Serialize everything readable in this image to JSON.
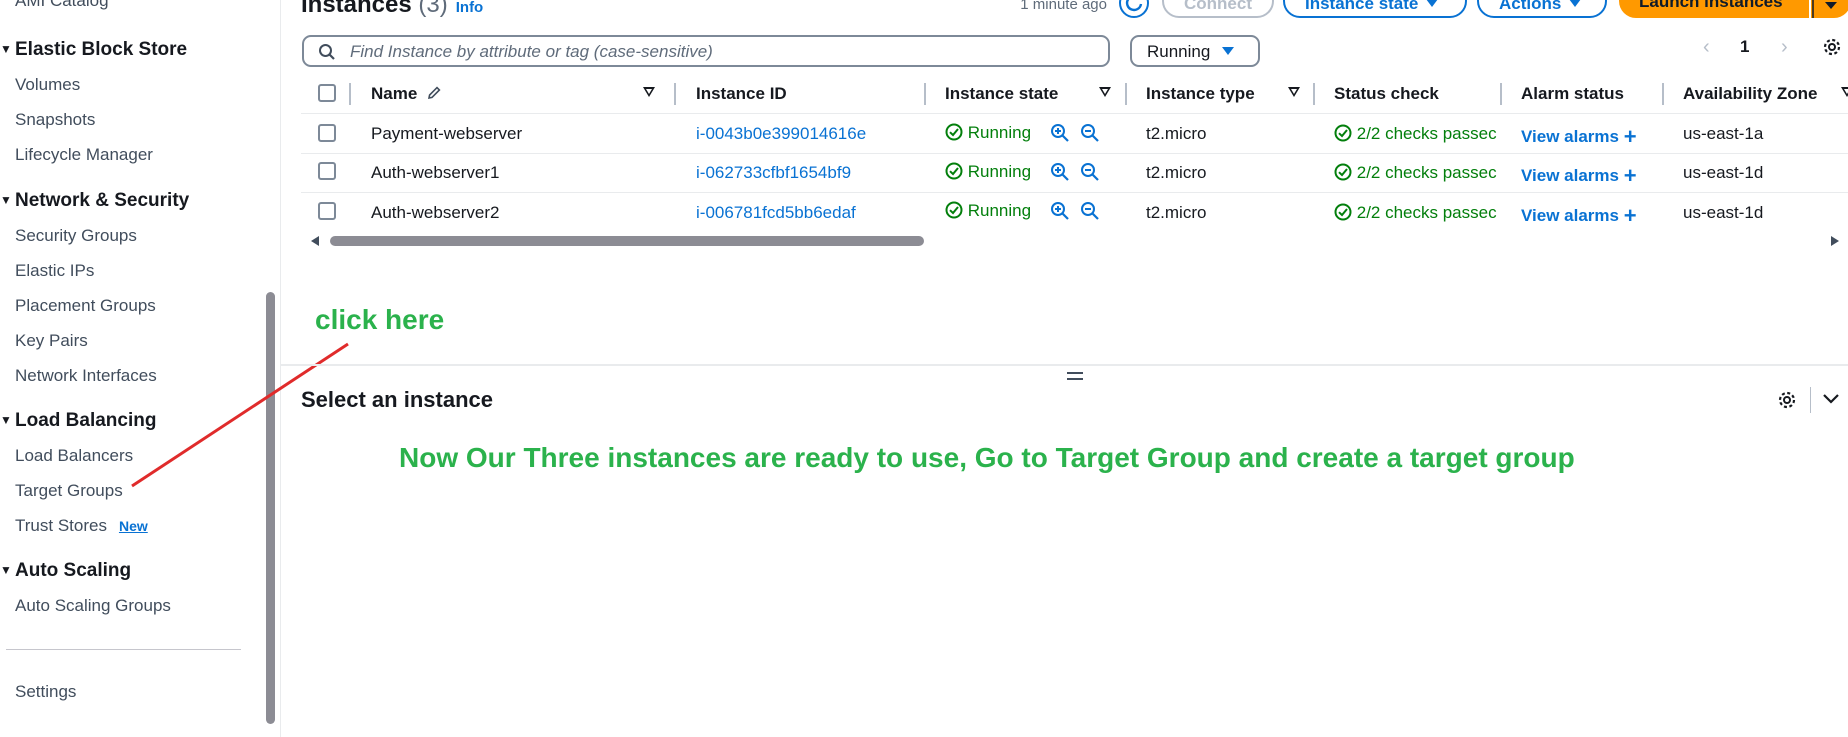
{
  "sidebar": {
    "clipped_item": "AMI Catalog",
    "sections": [
      {
        "title": "Elastic Block Store",
        "items": [
          "Volumes",
          "Snapshots",
          "Lifecycle Manager"
        ]
      },
      {
        "title": "Network & Security",
        "items": [
          "Security Groups",
          "Elastic IPs",
          "Placement Groups",
          "Key Pairs",
          "Network Interfaces"
        ]
      },
      {
        "title": "Load Balancing",
        "items": [
          "Load Balancers",
          "Target Groups",
          "Trust Stores"
        ]
      },
      {
        "title": "Auto Scaling",
        "items": [
          "Auto Scaling Groups"
        ]
      }
    ],
    "new_badge": "New",
    "settings": "Settings"
  },
  "instances": {
    "title": "Instances",
    "count": "(3)",
    "info": "Info",
    "last_updated": "1 minute ago",
    "buttons": {
      "connect": "Connect",
      "instance_state": "Instance state",
      "actions": "Actions",
      "launch": "Launch instances"
    }
  },
  "filter": {
    "search_placeholder": "Find Instance by attribute or tag (case-sensitive)",
    "state_filter": "Running",
    "page": "1"
  },
  "table": {
    "headers": [
      "Name",
      "Instance ID",
      "Instance state",
      "Instance type",
      "Status check",
      "Alarm status",
      "Availability Zone"
    ],
    "rows": [
      {
        "name": "Payment-webserver",
        "id": "i-0043b0e399014616e",
        "state": "Running",
        "type": "t2.micro",
        "status": "2/2 checks passec",
        "alarm": "View alarms",
        "az": "us-east-1a"
      },
      {
        "name": "Auth-webserver1",
        "id": "i-062733cfbf1654bf9",
        "state": "Running",
        "type": "t2.micro",
        "status": "2/2 checks passec",
        "alarm": "View alarms",
        "az": "us-east-1d"
      },
      {
        "name": "Auth-webserver2",
        "id": "i-006781fcd5bb6edaf",
        "state": "Running",
        "type": "t2.micro",
        "status": "2/2 checks passec",
        "alarm": "View alarms",
        "az": "us-east-1d"
      }
    ]
  },
  "annotation": {
    "click_here": "click here",
    "note": "Now Our Three instances are ready to use, Go to Target Group and create a target group",
    "color": "#2bb24c",
    "arrow_color": "#e02b2b"
  },
  "detail": {
    "title": "Select an instance"
  },
  "colors": {
    "link": "#0972d3",
    "ok": "#037f0c",
    "launch": "#ff9900"
  }
}
